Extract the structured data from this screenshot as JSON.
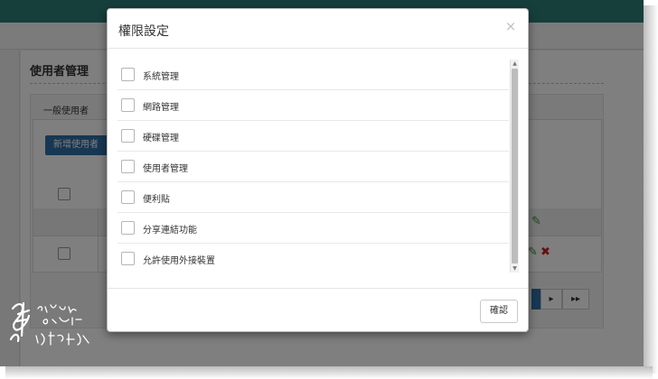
{
  "app": {
    "page_title": "使用者管理",
    "tab_label": "一般使用者",
    "add_user_label": "新增使用者"
  },
  "pager": {
    "next_icon": "chevron-right",
    "last_icon": "double-chevron-right"
  },
  "row_actions": {
    "edit_icon": "pencil-icon",
    "delete_icon": "delete-icon"
  },
  "modal": {
    "title": "權限設定",
    "close_label": "×",
    "confirm_label": "確認",
    "permissions": [
      {
        "label": "系統管理",
        "checked": false
      },
      {
        "label": "網路管理",
        "checked": false
      },
      {
        "label": "硬碟管理",
        "checked": false
      },
      {
        "label": "使用者管理",
        "checked": false
      },
      {
        "label": "便利貼",
        "checked": false
      },
      {
        "label": "分享連結功能",
        "checked": false
      },
      {
        "label": "允許使用外接裝置",
        "checked": false
      }
    ]
  },
  "colors": {
    "topbar": "#2d7f79",
    "primary_button": "#2f6fa6",
    "edit_icon": "#3a8f3a",
    "delete_icon": "#cc2222"
  }
}
